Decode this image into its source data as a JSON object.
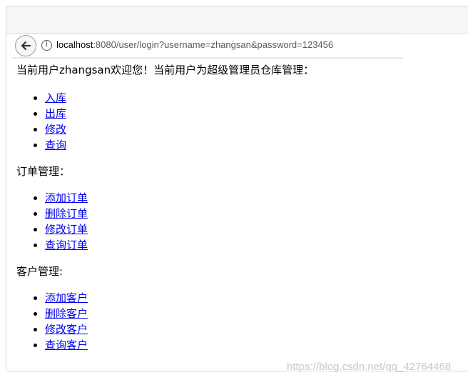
{
  "browser": {
    "back_icon": "back-arrow-icon",
    "info_icon_glyph": "i",
    "url_host": "localhost",
    "url_rest": ":8080/user/login?username=zhangsan&password=123456"
  },
  "page": {
    "welcome_text": "当前用户zhangsan欢迎您！当前用户为超级管理员仓库管理：",
    "warehouse_links": [
      "入库",
      "出库",
      "修改",
      "查询"
    ],
    "order_heading": "订单管理：",
    "order_links": [
      "添加订单",
      "删除订单",
      "修改订单",
      "查询订单"
    ],
    "customer_heading": "客户管理:",
    "customer_links": [
      "添加客户",
      "删除客户",
      "修改客户",
      "查询客户"
    ]
  },
  "watermark": "https://blog.csdn.net/qq_42764468",
  "colors": {
    "link": "#0000ee",
    "addressbar_border": "#dfe8f6"
  }
}
